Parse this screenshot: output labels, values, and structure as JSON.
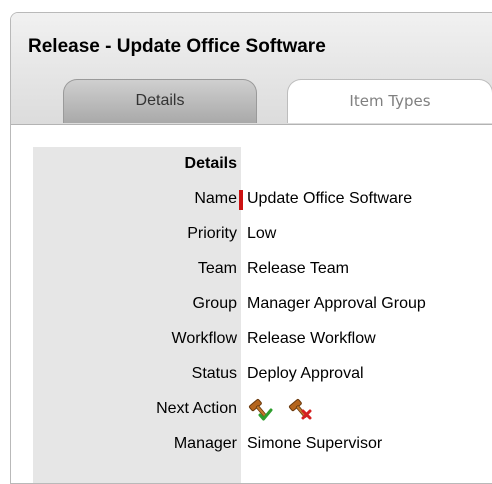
{
  "panel": {
    "title": "Release - Update Office Software"
  },
  "tabs": [
    {
      "label": "Details",
      "active": true
    },
    {
      "label": "Item Types",
      "active": false
    }
  ],
  "details": {
    "section_title": "Details",
    "fields": [
      {
        "label": "Name",
        "value": "Update Office Software",
        "required": true
      },
      {
        "label": "Priority",
        "value": "Low"
      },
      {
        "label": "Team",
        "value": "Release Team"
      },
      {
        "label": "Group",
        "value": "Manager Approval Group"
      },
      {
        "label": "Workflow",
        "value": "Release Workflow"
      },
      {
        "label": "Status",
        "value": "Deploy Approval"
      },
      {
        "label": "Next Action",
        "icons": [
          "approve-icon",
          "reject-icon"
        ]
      },
      {
        "label": "Manager",
        "value": "Simone Supervisor"
      }
    ]
  },
  "colors": {
    "required_marker": "#cc1111",
    "label_column_bg": "#e6e6e6",
    "header_bg": "#e4e4e4"
  }
}
